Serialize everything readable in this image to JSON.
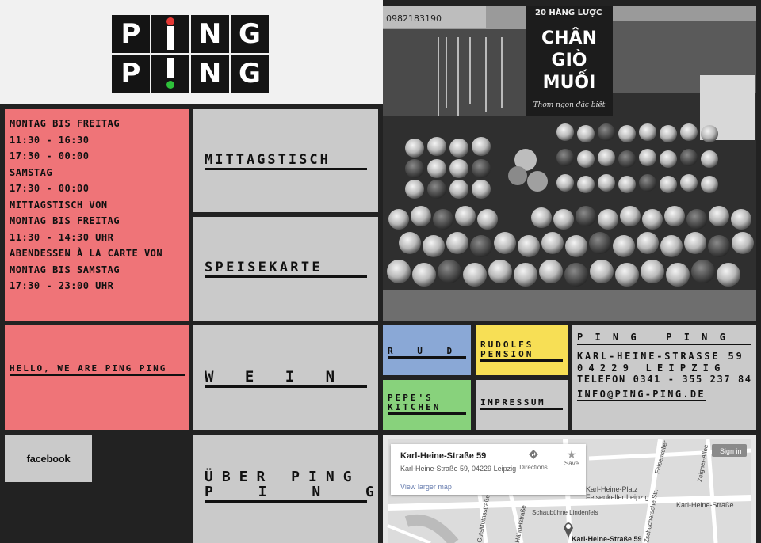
{
  "logo": {
    "row1": [
      "P",
      "I",
      "N",
      "G"
    ],
    "row2": [
      "P",
      "I",
      "N",
      "G"
    ]
  },
  "hours": [
    "MONTAG BIS FREITAG",
    "11:30 - 16:30",
    "17:30 - 00:00",
    "SAMSTAG",
    "17:30 - 00:00",
    "MITTAGSTISCH VON",
    "MONTAG BIS FREITAG",
    "11:30 - 14:30 UHR",
    "ABENDESSEN À LA CARTE VON",
    "MONTAG BIS SAMSTAG",
    "17:30 - 23:00 UHR"
  ],
  "nav": {
    "mittagstisch": "MITTAGSTISCH",
    "speisekarte": "SPEISEKARTE",
    "wein": "W E I N",
    "ueber_line1": "ÜBER PING",
    "ueber_line2": "P I N G",
    "hello": "HELLO, WE ARE PING PING",
    "facebook": "facebook"
  },
  "tiles": {
    "rudi": "R U D I",
    "rudolfs_line1": "RUDOLFS",
    "rudolfs_line2": "PENSION",
    "pepes_line1": "PEPE'S",
    "pepes_line2": "KITCHEN",
    "impressum": "IMPRESSUM"
  },
  "contact": {
    "name": "P I N G   P I N G",
    "street": "KARL-HEINE-STRASSE 59",
    "city": "04229 LEIPZIG",
    "phone": "TELEFON 0341 - 355 237 84",
    "email": "INFO@PING-PING.DE"
  },
  "photo_signs": {
    "main1": "CHÂN",
    "main2": "GIÒ",
    "main3": "MUỐI",
    "sub": "Thơm ngon đặc biệt",
    "top": "20 HÀNG LƯỢC",
    "phone": "0982183190"
  },
  "map": {
    "card_title": "Karl-Heine-Straße 59",
    "card_address": "Karl-Heine-Straße 59, 04229 Leipzig",
    "larger_map": "View larger map",
    "directions": "Directions",
    "save": "Save",
    "sign_in": "Sign in",
    "label_platz": "Karl-Heine-Platz",
    "label_felsenkeller": "Felsenkeller Leipzig",
    "label_street": "Karl-Heine-Straße",
    "label_schaubuehne": "Schaubühne Lindenfels",
    "label_pin": "Karl-Heine-Straße 59",
    "road_zschocher": "Zschochersche Str.",
    "road_zeigner": "Zeigner-Allee",
    "road_haehnel": "Hähnelstraße",
    "road_gutsmuths": "GutsMuthsstraße",
    "road_felsen": "Felsenkeller"
  },
  "colors": {
    "pink": "#ef7478",
    "grey": "#cacaca",
    "blue": "#8aa8d6",
    "yellow": "#f7df55",
    "green": "#88d27c",
    "dark": "#222222",
    "logo_dot_red": "#e53935",
    "logo_dot_green": "#2ec13a"
  }
}
